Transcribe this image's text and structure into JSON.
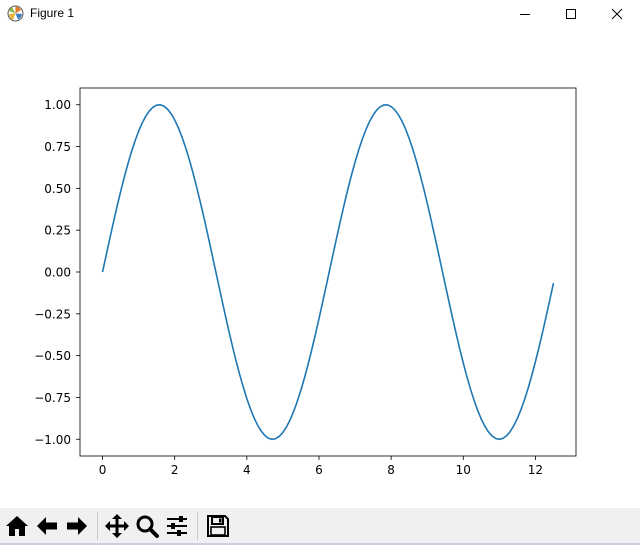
{
  "window": {
    "title": "Figure 1"
  },
  "toolbar": {
    "buttons": [
      {
        "name": "home-button",
        "icon": "home-icon"
      },
      {
        "name": "back-button",
        "icon": "arrow-left-icon"
      },
      {
        "name": "forward-button",
        "icon": "arrow-right-icon"
      },
      {
        "name": "pan-button",
        "icon": "move-icon"
      },
      {
        "name": "zoom-button",
        "icon": "magnifier-icon"
      },
      {
        "name": "configure-subplots-button",
        "icon": "sliders-icon"
      },
      {
        "name": "save-button",
        "icon": "floppy-disk-icon"
      }
    ]
  },
  "colors": {
    "line": "#1f77b4",
    "toolbar_bg": "#f0f0f0"
  },
  "chart_data": {
    "type": "line",
    "function": "sin(x)",
    "x_range": [
      0,
      12.5
    ],
    "sample_step": 0.1,
    "xlim": [
      -0.625,
      13.125
    ],
    "ylim": [
      -1.1,
      1.1
    ],
    "xticks": [
      0,
      2,
      4,
      6,
      8,
      10,
      12
    ],
    "yticks": [
      1.0,
      0.75,
      0.5,
      0.25,
      0.0,
      -0.25,
      -0.5,
      -0.75,
      -1.0
    ],
    "xtick_labels": [
      "0",
      "2",
      "4",
      "6",
      "8",
      "10",
      "12"
    ],
    "ytick_labels": [
      "1.00",
      "0.75",
      "0.50",
      "0.25",
      "0.00",
      "−0.25",
      "−0.50",
      "−0.75",
      "−1.00"
    ],
    "grid": false,
    "title": "",
    "xlabel": "",
    "ylabel": ""
  }
}
